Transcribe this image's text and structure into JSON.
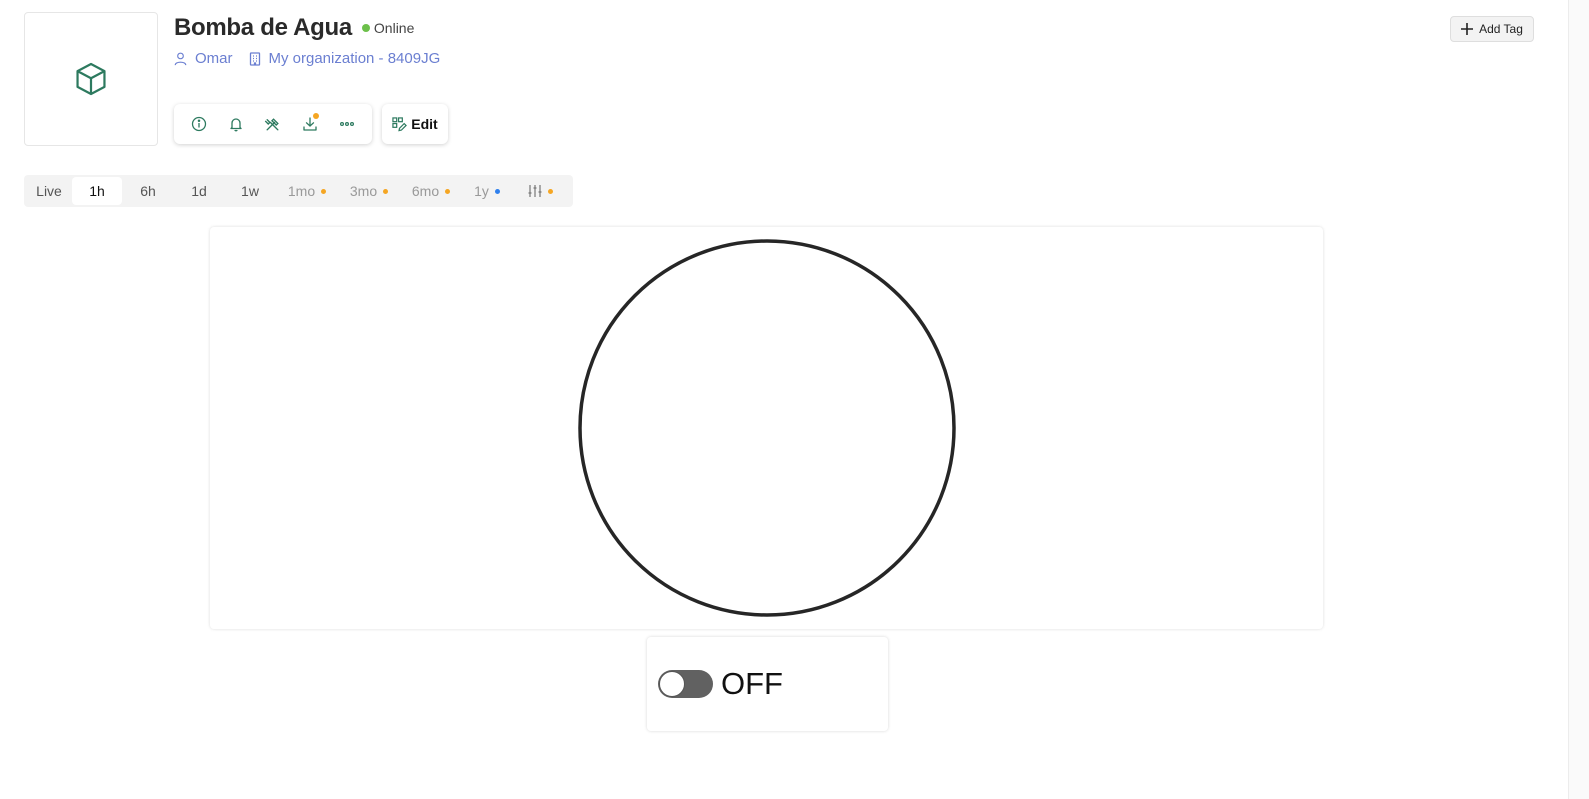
{
  "device": {
    "name": "Bomba de Agua",
    "status": "Online",
    "owner": "Omar",
    "organization": "My organization - 8409JG",
    "icon": "cube-icon"
  },
  "actions": {
    "items": [
      {
        "icon": "info-icon"
      },
      {
        "icon": "bell-icon"
      },
      {
        "icon": "tools-icon"
      },
      {
        "icon": "download-icon",
        "badge": true
      },
      {
        "icon": "more-icon"
      }
    ],
    "edit_label": "Edit"
  },
  "add_tag_label": "Add Tag",
  "time_ranges": [
    {
      "label": "Live"
    },
    {
      "label": "1h",
      "active": true
    },
    {
      "label": "6h"
    },
    {
      "label": "1d"
    },
    {
      "label": "1w"
    },
    {
      "label": "1mo",
      "dot": "#f5a623"
    },
    {
      "label": "3mo",
      "dot": "#f5a623"
    },
    {
      "label": "6mo",
      "dot": "#f5a623"
    },
    {
      "label": "1y",
      "dot": "#2f80ed"
    },
    {
      "icon": "sliders-icon",
      "dot": "#f5a623"
    }
  ],
  "switch": {
    "state": "OFF",
    "on": false
  },
  "colors": {
    "accent": "#2d7a5f",
    "link": "#6b7fd1",
    "online": "#6cc04a",
    "warning_dot": "#f5a623",
    "info_dot": "#2f80ed"
  }
}
